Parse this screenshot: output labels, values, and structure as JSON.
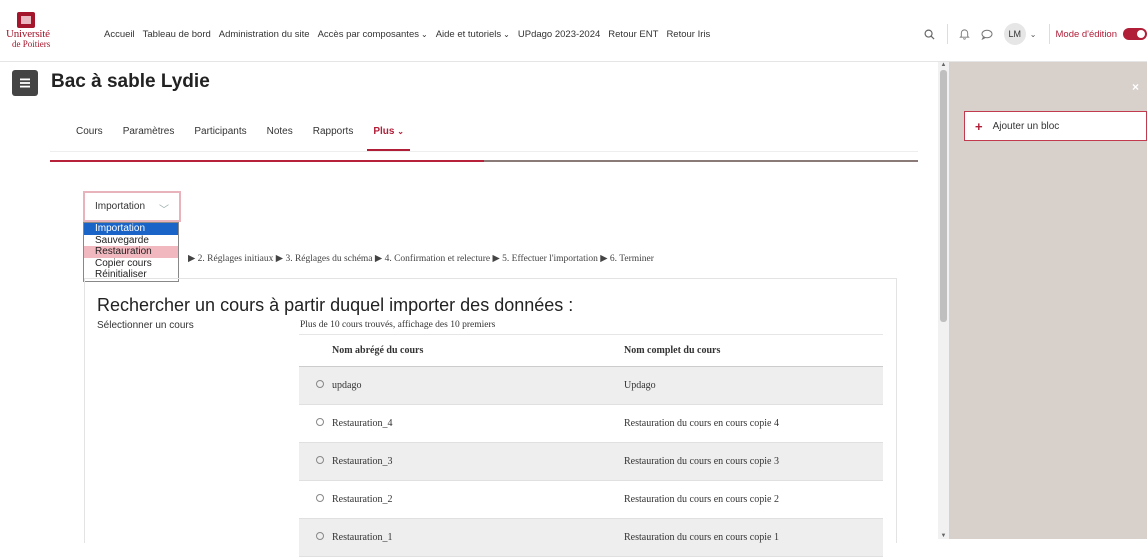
{
  "header": {
    "logo_line1": "Université",
    "logo_line2": "de Poitiers",
    "nav": [
      {
        "label": "Accueil"
      },
      {
        "label": "Tableau de bord"
      },
      {
        "label": "Administration du site"
      },
      {
        "label": "Accès par composantes",
        "dropdown": true
      },
      {
        "label": "Aide et tutoriels",
        "dropdown": true
      },
      {
        "label": "UPdago 2023-2024"
      },
      {
        "label": "Retour ENT"
      },
      {
        "label": "Retour Iris"
      }
    ],
    "avatar_initials": "LM",
    "edit_mode_label": "Mode d'édition",
    "edit_mode_on": true
  },
  "page": {
    "title": "Bac à sable Lydie"
  },
  "secondary_nav": {
    "items": [
      "Cours",
      "Paramètres",
      "Participants",
      "Notes",
      "Rapports"
    ],
    "more": "Plus"
  },
  "action_select": {
    "value": "Importation",
    "options": [
      "Importation",
      "Sauvegarde",
      "Restauration",
      "Copier cours",
      "Réinitialiser"
    ],
    "selected_index": 0,
    "hover_index": 2
  },
  "steps": "▶ 2. Réglages initiaux ▶ 3. Réglages du schéma ▶ 4. Confirmation et relecture ▶ 5. Effectuer l'importation ▶ 6. Terminer",
  "search": {
    "title": "Rechercher un cours à partir duquel importer des données :",
    "select_label": "Sélectionner un cours",
    "found_text": "Plus de 10 cours trouvés, affichage des 10 premiers",
    "columns": [
      "Nom abrégé du cours",
      "Nom complet du cours"
    ],
    "rows": [
      {
        "short": "updago",
        "full": "Updago"
      },
      {
        "short": "Restauration_4",
        "full": "Restauration du cours en cours copie 4"
      },
      {
        "short": "Restauration_3",
        "full": "Restauration du cours en cours copie 3"
      },
      {
        "short": "Restauration_2",
        "full": "Restauration du cours en cours copie 2"
      },
      {
        "short": "Restauration_1",
        "full": "Restauration du cours en cours copie 1"
      }
    ]
  },
  "drawer": {
    "add_block_label": "Ajouter un bloc",
    "close_symbol": "×"
  },
  "colors": {
    "accent": "#b01e38",
    "drawer_bg": "#d8d0cb",
    "select_highlight": "#1a64c8"
  }
}
